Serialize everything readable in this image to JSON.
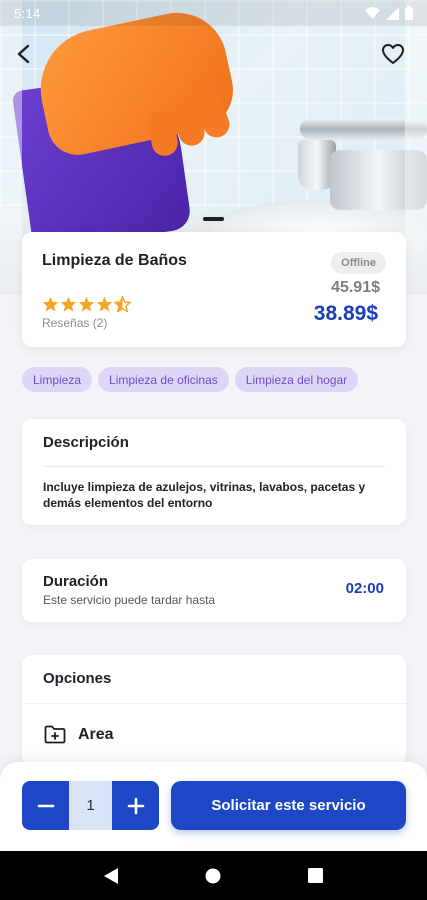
{
  "status_bar": {
    "time": "5:14"
  },
  "service": {
    "title": "Limpieza de Baños",
    "status_badge": "Offline",
    "rating": 4.5,
    "reviews_label": "Reseñas (2)",
    "old_price": "45.91$",
    "price": "38.89$"
  },
  "tags": [
    "Limpieza",
    "Limpieza de oficinas",
    "Limpieza del hogar"
  ],
  "description": {
    "heading": "Descripción",
    "body": "Incluye limpieza de azulejos, vitrinas, lavabos, pacetas y demás elementos del entorno"
  },
  "duration": {
    "heading": "Duración",
    "subtitle": "Este servicio puede tardar hasta",
    "value": "02:00"
  },
  "options": {
    "heading": "Opciones",
    "items": [
      {
        "label": "Area",
        "icon": "folder-plus-icon"
      }
    ]
  },
  "action_bar": {
    "quantity": "1",
    "request_label": "Solicitar este servicio"
  },
  "colors": {
    "primary": "#1d47c7",
    "price": "#1b3fb8",
    "star": "#f5a623",
    "tag_bg": "#ded6f6",
    "tag_text": "#6c4fc9"
  }
}
